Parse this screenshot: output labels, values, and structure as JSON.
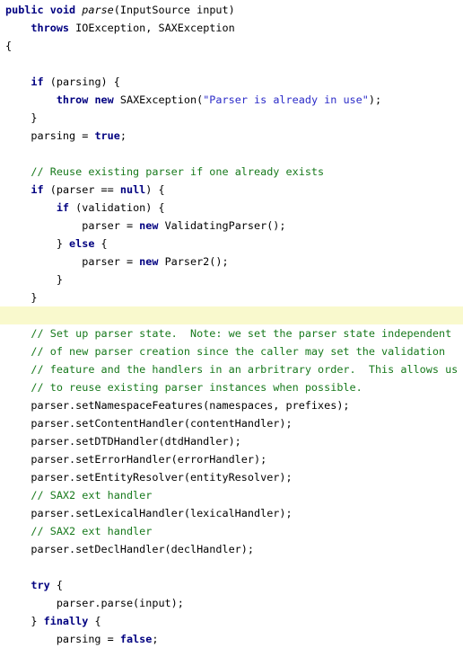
{
  "editor": {
    "title": "Java Source Code View",
    "language": "Java",
    "font_size_px": 11.8,
    "line_height_px": 20,
    "background_color": "#ffffff",
    "highlight_color": "#f9f9cd",
    "colors": {
      "keyword": "#000080",
      "string": "#2b2bc8",
      "comment": "#17791c",
      "plain": "#000000",
      "italic_identifier": "#000000"
    }
  },
  "code": {
    "lines": [
      {
        "index": 1,
        "highlighted": false,
        "tokens": [
          {
            "t": "kw",
            "s": "public"
          },
          {
            "t": "plain",
            "s": " "
          },
          {
            "t": "kw",
            "s": "void"
          },
          {
            "t": "plain",
            "s": " "
          },
          {
            "t": "ital",
            "s": "parse"
          },
          {
            "t": "plain",
            "s": "(InputSource input)"
          }
        ]
      },
      {
        "index": 2,
        "highlighted": false,
        "tokens": [
          {
            "t": "plain",
            "s": "    "
          },
          {
            "t": "kw",
            "s": "throws"
          },
          {
            "t": "plain",
            "s": " IOException, SAXException"
          }
        ]
      },
      {
        "index": 3,
        "highlighted": false,
        "tokens": [
          {
            "t": "plain",
            "s": "{"
          }
        ]
      },
      {
        "index": 4,
        "highlighted": false,
        "tokens": [
          {
            "t": "plain",
            "s": ""
          }
        ]
      },
      {
        "index": 5,
        "highlighted": false,
        "tokens": [
          {
            "t": "plain",
            "s": "    "
          },
          {
            "t": "kw",
            "s": "if"
          },
          {
            "t": "plain",
            "s": " (parsing) {"
          }
        ]
      },
      {
        "index": 6,
        "highlighted": false,
        "tokens": [
          {
            "t": "plain",
            "s": "        "
          },
          {
            "t": "kw",
            "s": "throw"
          },
          {
            "t": "plain",
            "s": " "
          },
          {
            "t": "kw",
            "s": "new"
          },
          {
            "t": "plain",
            "s": " SAXException("
          },
          {
            "t": "str",
            "s": "\"Parser is already in use\""
          },
          {
            "t": "plain",
            "s": ");"
          }
        ]
      },
      {
        "index": 7,
        "highlighted": false,
        "tokens": [
          {
            "t": "plain",
            "s": "    }"
          }
        ]
      },
      {
        "index": 8,
        "highlighted": false,
        "tokens": [
          {
            "t": "plain",
            "s": "    parsing = "
          },
          {
            "t": "kw",
            "s": "true"
          },
          {
            "t": "plain",
            "s": ";"
          }
        ]
      },
      {
        "index": 9,
        "highlighted": false,
        "tokens": [
          {
            "t": "plain",
            "s": ""
          }
        ]
      },
      {
        "index": 10,
        "highlighted": false,
        "tokens": [
          {
            "t": "plain",
            "s": "    "
          },
          {
            "t": "com",
            "s": "// Reuse existing parser if one already exists"
          }
        ]
      },
      {
        "index": 11,
        "highlighted": false,
        "tokens": [
          {
            "t": "plain",
            "s": "    "
          },
          {
            "t": "kw",
            "s": "if"
          },
          {
            "t": "plain",
            "s": " (parser == "
          },
          {
            "t": "kw",
            "s": "null"
          },
          {
            "t": "plain",
            "s": ") {"
          }
        ]
      },
      {
        "index": 12,
        "highlighted": false,
        "tokens": [
          {
            "t": "plain",
            "s": "        "
          },
          {
            "t": "kw",
            "s": "if"
          },
          {
            "t": "plain",
            "s": " (validation) {"
          }
        ]
      },
      {
        "index": 13,
        "highlighted": false,
        "tokens": [
          {
            "t": "plain",
            "s": "            parser = "
          },
          {
            "t": "kw",
            "s": "new"
          },
          {
            "t": "plain",
            "s": " ValidatingParser();"
          }
        ]
      },
      {
        "index": 14,
        "highlighted": false,
        "tokens": [
          {
            "t": "plain",
            "s": "        } "
          },
          {
            "t": "kw",
            "s": "else"
          },
          {
            "t": "plain",
            "s": " {"
          }
        ]
      },
      {
        "index": 15,
        "highlighted": false,
        "tokens": [
          {
            "t": "plain",
            "s": "            parser = "
          },
          {
            "t": "kw",
            "s": "new"
          },
          {
            "t": "plain",
            "s": " Parser2();"
          }
        ]
      },
      {
        "index": 16,
        "highlighted": false,
        "tokens": [
          {
            "t": "plain",
            "s": "        }"
          }
        ]
      },
      {
        "index": 17,
        "highlighted": false,
        "tokens": [
          {
            "t": "plain",
            "s": "    }"
          }
        ]
      },
      {
        "index": 18,
        "highlighted": true,
        "tokens": [
          {
            "t": "plain",
            "s": ""
          }
        ]
      },
      {
        "index": 19,
        "highlighted": false,
        "tokens": [
          {
            "t": "plain",
            "s": "    "
          },
          {
            "t": "com",
            "s": "// Set up parser state.  Note: we set the parser state independent"
          }
        ]
      },
      {
        "index": 20,
        "highlighted": false,
        "tokens": [
          {
            "t": "plain",
            "s": "    "
          },
          {
            "t": "com",
            "s": "// of new parser creation since the caller may set the validation"
          }
        ]
      },
      {
        "index": 21,
        "highlighted": false,
        "tokens": [
          {
            "t": "plain",
            "s": "    "
          },
          {
            "t": "com",
            "s": "// feature and the handlers in an arbritrary order.  This allows us"
          }
        ]
      },
      {
        "index": 22,
        "highlighted": false,
        "tokens": [
          {
            "t": "plain",
            "s": "    "
          },
          {
            "t": "com",
            "s": "// to reuse existing parser instances when possible."
          }
        ]
      },
      {
        "index": 23,
        "highlighted": false,
        "tokens": [
          {
            "t": "plain",
            "s": "    parser.setNamespaceFeatures(namespaces, prefixes);"
          }
        ]
      },
      {
        "index": 24,
        "highlighted": false,
        "tokens": [
          {
            "t": "plain",
            "s": "    parser.setContentHandler(contentHandler);"
          }
        ]
      },
      {
        "index": 25,
        "highlighted": false,
        "tokens": [
          {
            "t": "plain",
            "s": "    parser.setDTDHandler(dtdHandler);"
          }
        ]
      },
      {
        "index": 26,
        "highlighted": false,
        "tokens": [
          {
            "t": "plain",
            "s": "    parser.setErrorHandler(errorHandler);"
          }
        ]
      },
      {
        "index": 27,
        "highlighted": false,
        "tokens": [
          {
            "t": "plain",
            "s": "    parser.setEntityResolver(entityResolver);"
          }
        ]
      },
      {
        "index": 28,
        "highlighted": false,
        "tokens": [
          {
            "t": "plain",
            "s": "    "
          },
          {
            "t": "com",
            "s": "// SAX2 ext handler"
          }
        ]
      },
      {
        "index": 29,
        "highlighted": false,
        "tokens": [
          {
            "t": "plain",
            "s": "    parser.setLexicalHandler(lexicalHandler);"
          }
        ]
      },
      {
        "index": 30,
        "highlighted": false,
        "tokens": [
          {
            "t": "plain",
            "s": "    "
          },
          {
            "t": "com",
            "s": "// SAX2 ext handler"
          }
        ]
      },
      {
        "index": 31,
        "highlighted": false,
        "tokens": [
          {
            "t": "plain",
            "s": "    parser.setDeclHandler(declHandler);"
          }
        ]
      },
      {
        "index": 32,
        "highlighted": false,
        "tokens": [
          {
            "t": "plain",
            "s": ""
          }
        ]
      },
      {
        "index": 33,
        "highlighted": false,
        "tokens": [
          {
            "t": "plain",
            "s": "    "
          },
          {
            "t": "kw",
            "s": "try"
          },
          {
            "t": "plain",
            "s": " {"
          }
        ]
      },
      {
        "index": 34,
        "highlighted": false,
        "tokens": [
          {
            "t": "plain",
            "s": "        parser.parse(input);"
          }
        ]
      },
      {
        "index": 35,
        "highlighted": false,
        "tokens": [
          {
            "t": "plain",
            "s": "    } "
          },
          {
            "t": "kw",
            "s": "finally"
          },
          {
            "t": "plain",
            "s": " {"
          }
        ]
      },
      {
        "index": 36,
        "highlighted": false,
        "tokens": [
          {
            "t": "plain",
            "s": "        parsing = "
          },
          {
            "t": "kw",
            "s": "false"
          },
          {
            "t": "plain",
            "s": ";"
          }
        ]
      }
    ]
  }
}
